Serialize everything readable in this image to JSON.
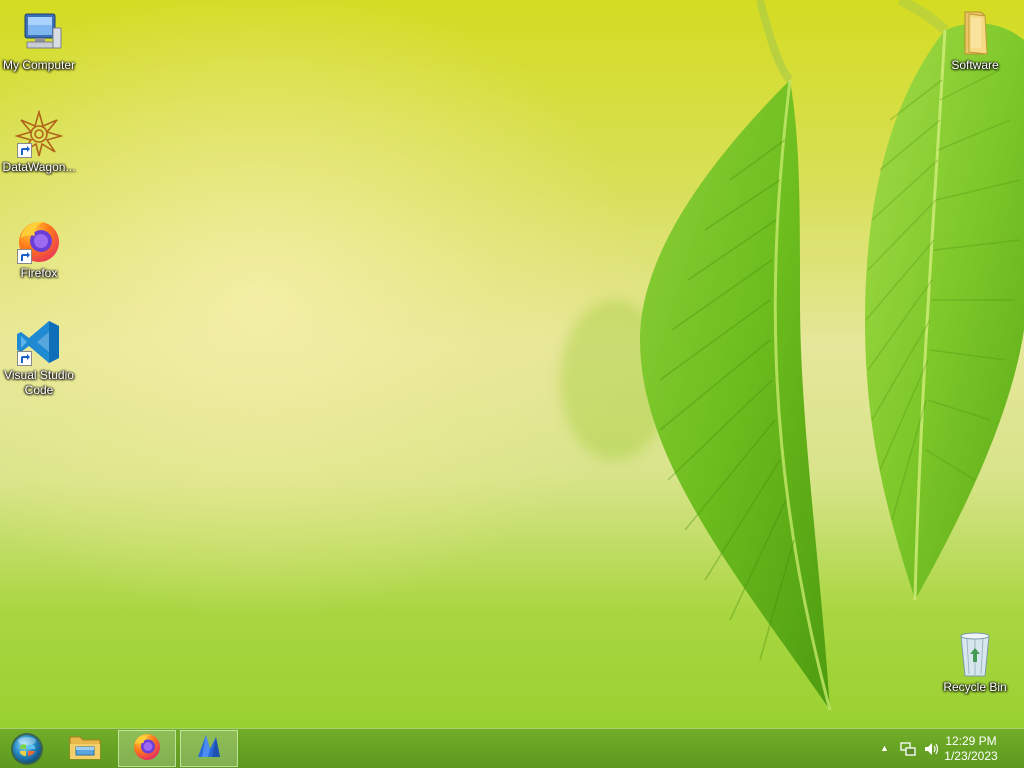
{
  "desktop": {
    "icons": [
      {
        "label": "My Computer",
        "icon": "computer-icon"
      },
      {
        "label": "DataWagon...",
        "icon": "datawagon-icon"
      },
      {
        "label": "Firefox",
        "icon": "firefox-icon"
      },
      {
        "label": "Visual Studio Code",
        "icon": "vscode-icon"
      },
      {
        "label": "Software",
        "icon": "folder-icon"
      },
      {
        "label": "Recycle Bin",
        "icon": "recycle-bin-icon"
      }
    ]
  },
  "taskbar": {
    "pinned": [
      {
        "icon": "file-explorer-icon",
        "active": false
      },
      {
        "icon": "firefox-icon",
        "active": true
      },
      {
        "icon": "app-icon",
        "active": true
      }
    ],
    "tray": {
      "show_hidden": "▲",
      "icons": [
        "network-icon",
        "volume-icon"
      ]
    },
    "clock": {
      "time": "12:29 PM",
      "date": "1/23/2023"
    }
  },
  "colors": {
    "accent": "#6aaa28",
    "wallpaper_top": "#d4dc22",
    "wallpaper_bottom": "#94cf2c"
  }
}
